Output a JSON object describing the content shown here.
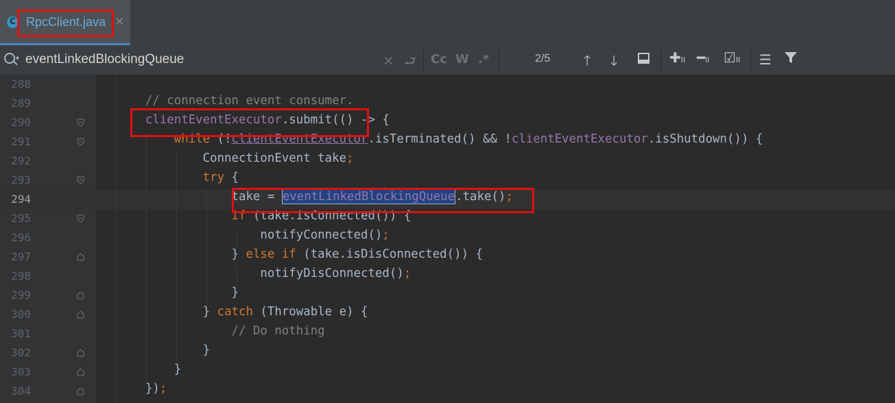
{
  "tab": {
    "label": "RpcClient.java",
    "close": "×"
  },
  "search": {
    "query": "eventLinkedBlockingQueue",
    "counter": "2/5",
    "clear": "×",
    "cc": "Cc",
    "w": "W",
    "regex": ".*"
  },
  "icons": {
    "search": "search-icon",
    "clear": "clear-icon",
    "replace": "replace-history-icon",
    "up": "arrow-up-icon",
    "down": "arrow-down-icon",
    "select_all": "select-all-icon",
    "add_selection": "add-selection-icon",
    "remove_selection": "remove-selection-icon",
    "select_all_occurrences": "select-all-occurrences-icon",
    "filter_options": "filter-options-icon",
    "filter": "filter-icon"
  },
  "editor": {
    "lines": [
      {
        "no": "288",
        "parts": []
      },
      {
        "no": "289",
        "parts": [
          {
            "t": "    // connection event consumer.",
            "c": "cm"
          }
        ]
      },
      {
        "no": "290",
        "parts": [
          {
            "t": "    "
          },
          {
            "t": "clientEventExecutor",
            "c": "fld"
          },
          {
            "t": ".submit(() -> {"
          }
        ]
      },
      {
        "no": "291",
        "parts": [
          {
            "t": "        "
          },
          {
            "t": "while",
            "c": "kw"
          },
          {
            "t": " (!"
          },
          {
            "t": "clientEventExecutor",
            "c": "fld ul"
          },
          {
            "t": ".isTerminated() && !"
          },
          {
            "t": "clientEventExecutor",
            "c": "fld"
          },
          {
            "t": ".isShutdown()) {"
          }
        ]
      },
      {
        "no": "292",
        "parts": [
          {
            "t": "            ConnectionEvent take"
          },
          {
            "t": ";",
            "c": "kw"
          }
        ]
      },
      {
        "no": "293",
        "parts": [
          {
            "t": "            "
          },
          {
            "t": "try",
            "c": "kw"
          },
          {
            "t": " {"
          }
        ]
      },
      {
        "no": "294",
        "parts": [
          {
            "t": "                take = "
          },
          {
            "t": "eventLinkedBlockingQueue",
            "c": "match"
          },
          {
            "t": ".take()"
          },
          {
            "t": ";",
            "c": "kw"
          }
        ]
      },
      {
        "no": "295",
        "parts": [
          {
            "t": "                "
          },
          {
            "t": "if",
            "c": "kw"
          },
          {
            "t": " (take.isConnected()) {"
          }
        ]
      },
      {
        "no": "296",
        "parts": [
          {
            "t": "                    notifyConnected()"
          },
          {
            "t": ";",
            "c": "kw"
          }
        ]
      },
      {
        "no": "297",
        "parts": [
          {
            "t": "                } "
          },
          {
            "t": "else if",
            "c": "kw"
          },
          {
            "t": " (take.isDisConnected()) {"
          }
        ]
      },
      {
        "no": "298",
        "parts": [
          {
            "t": "                    notifyDisConnected()"
          },
          {
            "t": ";",
            "c": "kw"
          }
        ]
      },
      {
        "no": "299",
        "parts": [
          {
            "t": "                }"
          }
        ]
      },
      {
        "no": "300",
        "parts": [
          {
            "t": "            } "
          },
          {
            "t": "catch",
            "c": "kw"
          },
          {
            "t": " (Throwable e) {"
          }
        ]
      },
      {
        "no": "301",
        "parts": [
          {
            "t": "                // Do nothing",
            "c": "cm"
          }
        ]
      },
      {
        "no": "302",
        "parts": [
          {
            "t": "            }"
          }
        ]
      },
      {
        "no": "303",
        "parts": [
          {
            "t": "        }"
          }
        ]
      },
      {
        "no": "304",
        "parts": [
          {
            "t": "    })"
          },
          {
            "t": ";",
            "c": "kw"
          }
        ]
      }
    ]
  }
}
